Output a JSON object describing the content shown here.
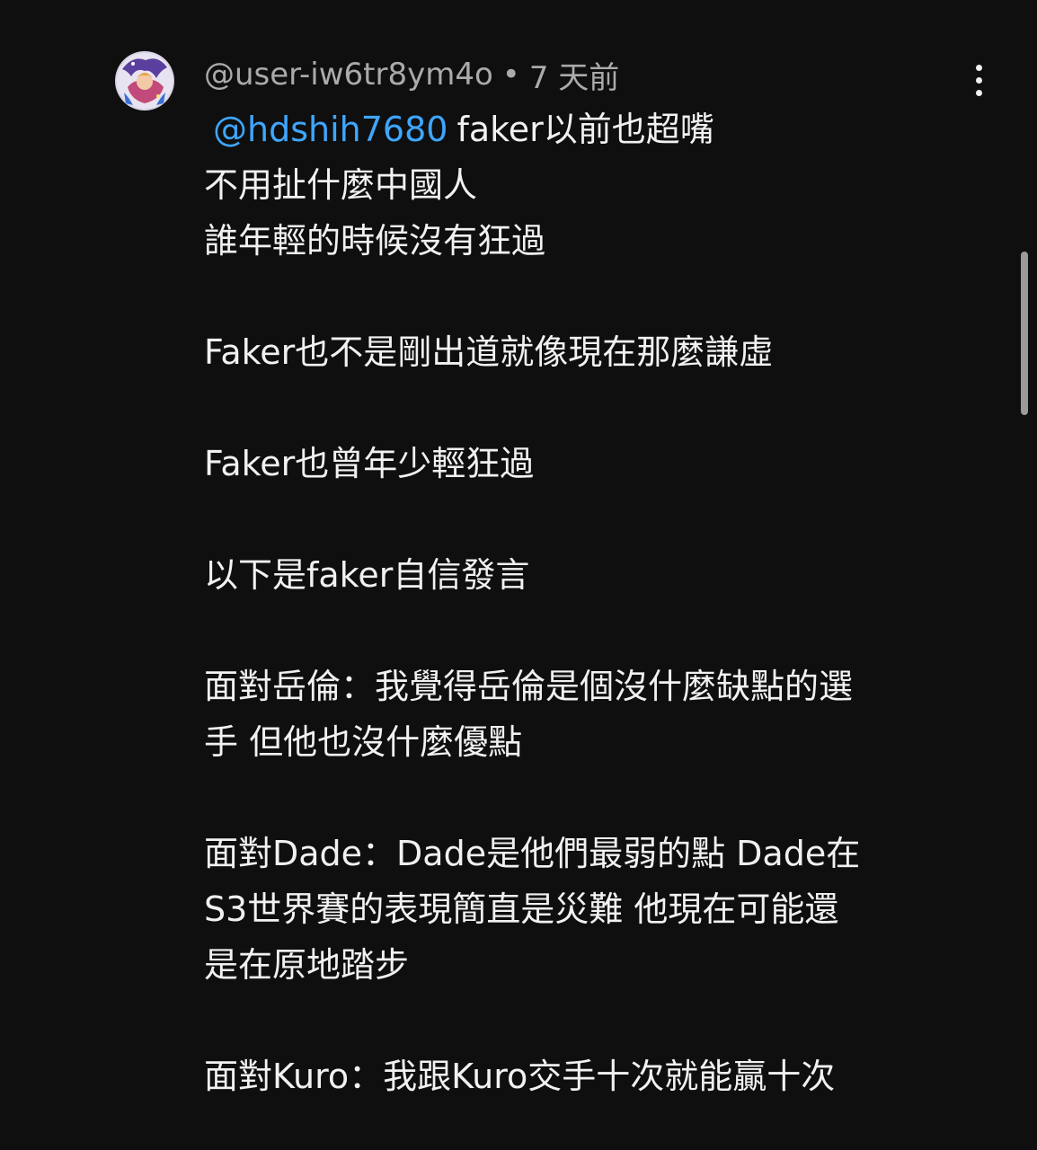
{
  "comment": {
    "author": "@user-iw6tr8ym4o",
    "separator": "•",
    "time": "7 天前",
    "mention": "@hdshih7680",
    "lines": {
      "l1": "faker以前也超嘴",
      "l2": "不用扯什麼中國人",
      "l3": "誰年輕的時候沒有狂過",
      "l4": "Faker也不是剛出道就像現在那麼謙虛",
      "l5": "Faker也曾年少輕狂過",
      "l6": "以下是faker自信發言",
      "l7": "面對岳倫：我覺得岳倫是個沒什麼缺點的選",
      "l8": "手 但他也沒什麼優點",
      "l9": "面對Dade：Dade是他們最弱的點 Dade在",
      "l10": "S3世界賽的表現簡直是災難 他現在可能還",
      "l11": "是在原地踏步",
      "l12": "面對Kuro：我跟Kuro交手十次就能贏十次"
    }
  },
  "icons": {
    "avatar": "user-avatar",
    "menu": "more-vertical-icon"
  },
  "colors": {
    "background": "#0f0f0f",
    "text": "#f1f1f1",
    "secondary_text": "#aaaaaa",
    "mention": "#3ea6ff"
  }
}
